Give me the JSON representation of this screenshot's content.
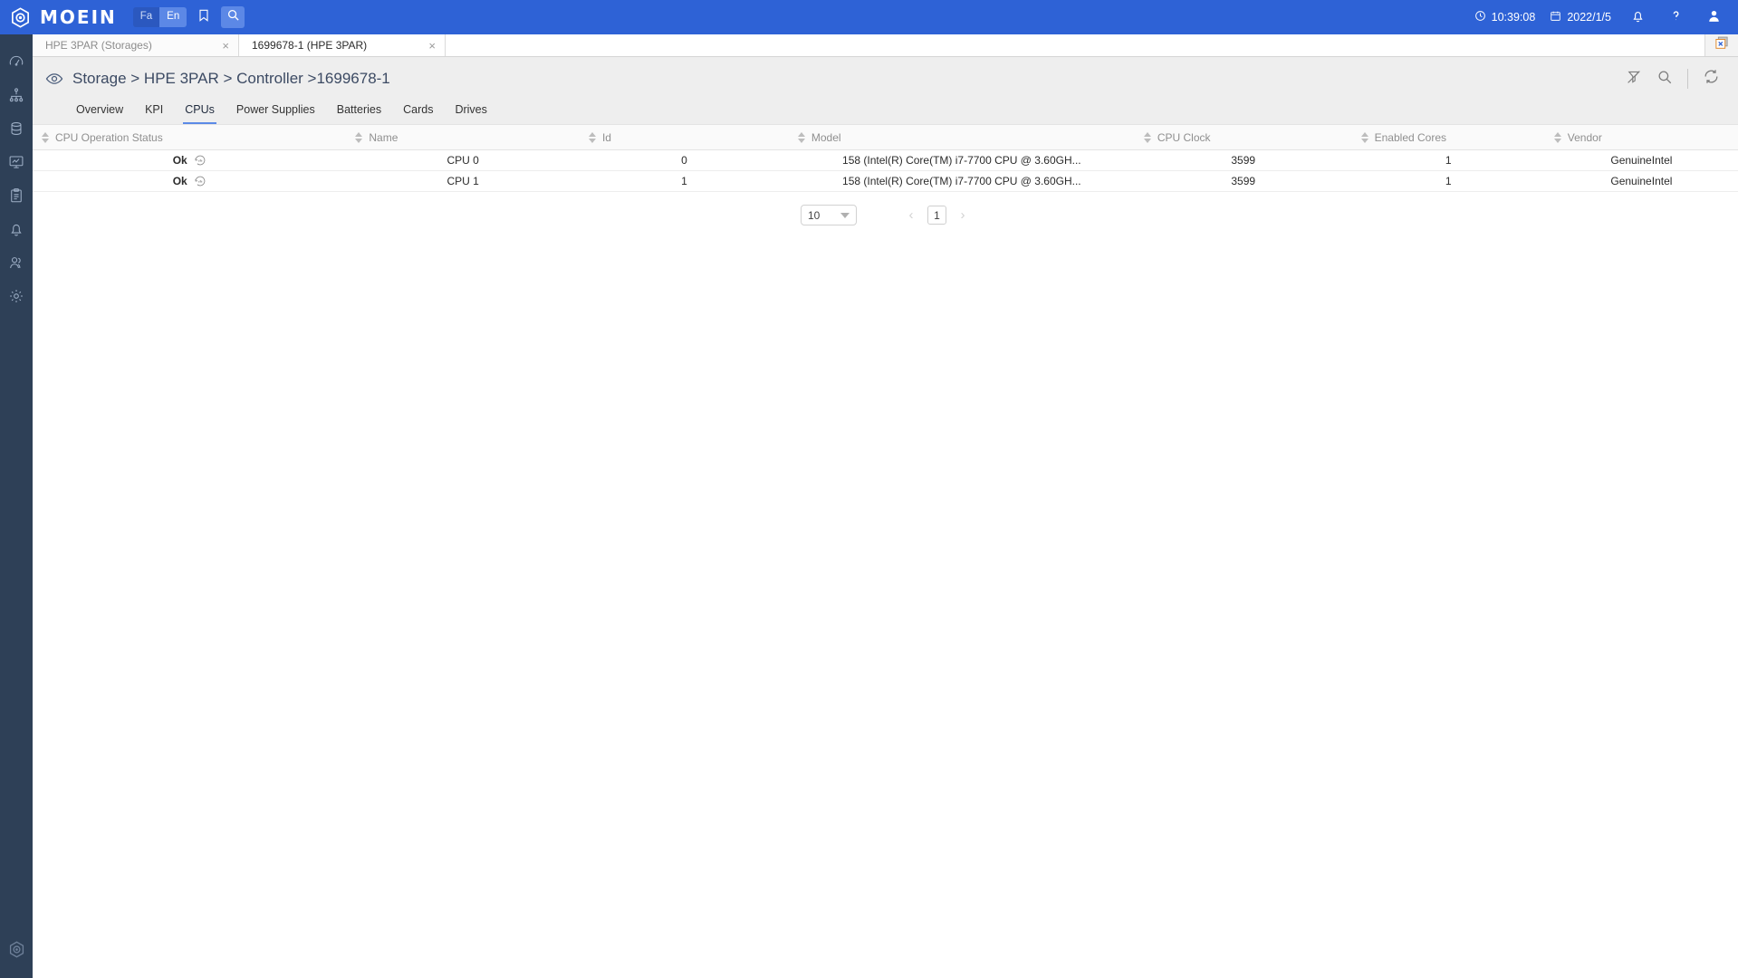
{
  "topbar": {
    "brand_name": "MOEIN",
    "brand_icon": "hexagon-logo-icon",
    "lang_fa": "Fa",
    "lang_en": "En",
    "bookmark_icon": "bookmark-icon",
    "search_icon": "search-icon",
    "time": "10:39:08",
    "time_icon": "clock-icon",
    "date": "2022/1/5",
    "date_icon": "calendar-icon",
    "notifications_icon": "bell-icon",
    "help_icon": "question-mark-icon",
    "profile_icon": "user-avatar-icon",
    "accent_color": "#2e62d6",
    "active_lang_color": "#5c88e6"
  },
  "sidebar": {
    "background_color": "#2e4057",
    "items": [
      {
        "name": "dashboard",
        "icon": "gauge-icon"
      },
      {
        "name": "topology",
        "icon": "hierarchy-icon"
      },
      {
        "name": "storage",
        "icon": "database-icon"
      },
      {
        "name": "monitoring",
        "icon": "monitor-chart-icon"
      },
      {
        "name": "reports",
        "icon": "clipboard-icon"
      },
      {
        "name": "alerts",
        "icon": "bell-icon"
      },
      {
        "name": "users",
        "icon": "users-icon"
      },
      {
        "name": "settings",
        "icon": "gear-icon"
      }
    ],
    "footer_logo_icon": "hexagon-logo-icon"
  },
  "tabstrip": {
    "tabs": [
      {
        "label": "HPE 3PAR (Storages)",
        "active": false
      },
      {
        "label": "1699678-1 (HPE 3PAR)",
        "active": true
      }
    ],
    "close_label": "×",
    "close_all_icon": "close-all-windows-icon"
  },
  "page": {
    "eye_icon": "eye-icon",
    "breadcrumb": "Storage > HPE 3PAR > Controller >1699678-1",
    "actions": [
      {
        "name": "clear-filter",
        "icon": "filter-off-icon"
      },
      {
        "name": "search",
        "icon": "search-icon"
      },
      {
        "name": "refresh",
        "icon": "refresh-icon"
      }
    ]
  },
  "subtabs": {
    "items": [
      {
        "label": "Overview",
        "active": false
      },
      {
        "label": "KPI",
        "active": false
      },
      {
        "label": "CPUs",
        "active": true
      },
      {
        "label": "Power Supplies",
        "active": false
      },
      {
        "label": "Batteries",
        "active": false
      },
      {
        "label": "Cards",
        "active": false
      },
      {
        "label": "Drives",
        "active": false
      }
    ],
    "active_underline_color": "#5b8ae6"
  },
  "table": {
    "columns": [
      {
        "label": "CPU Operation Status",
        "width": "19.5%",
        "align": "center"
      },
      {
        "label": "Name",
        "width": "14.5%",
        "align": "center"
      },
      {
        "label": "Id",
        "width": "13%",
        "align": "center"
      },
      {
        "label": "Model",
        "width": "21.5%",
        "align": "center"
      },
      {
        "label": "CPU Clock",
        "width": "13.5%",
        "align": "center"
      },
      {
        "label": "Enabled Cores",
        "width": "12%",
        "align": "center"
      },
      {
        "label": "Vendor",
        "width": "12%",
        "align": "center"
      }
    ],
    "rows": [
      {
        "status": "Ok",
        "status_chart_icon": "chart-history-icon",
        "name": "CPU 0",
        "id": "0",
        "model": "158 (Intel(R) Core(TM) i7-7700 CPU @ 3.60GH...",
        "cpu_clock": "3599",
        "enabled_cores": "1",
        "vendor": "GenuineIntel"
      },
      {
        "status": "Ok",
        "status_chart_icon": "chart-history-icon",
        "name": "CPU 1",
        "id": "1",
        "model": "158 (Intel(R) Core(TM) i7-7700 CPU @ 3.60GH...",
        "cpu_clock": "3599",
        "enabled_cores": "1",
        "vendor": "GenuineIntel"
      }
    ]
  },
  "pagination": {
    "page_size": "10",
    "prev_label": "‹",
    "next_label": "›",
    "current_page": "1"
  }
}
